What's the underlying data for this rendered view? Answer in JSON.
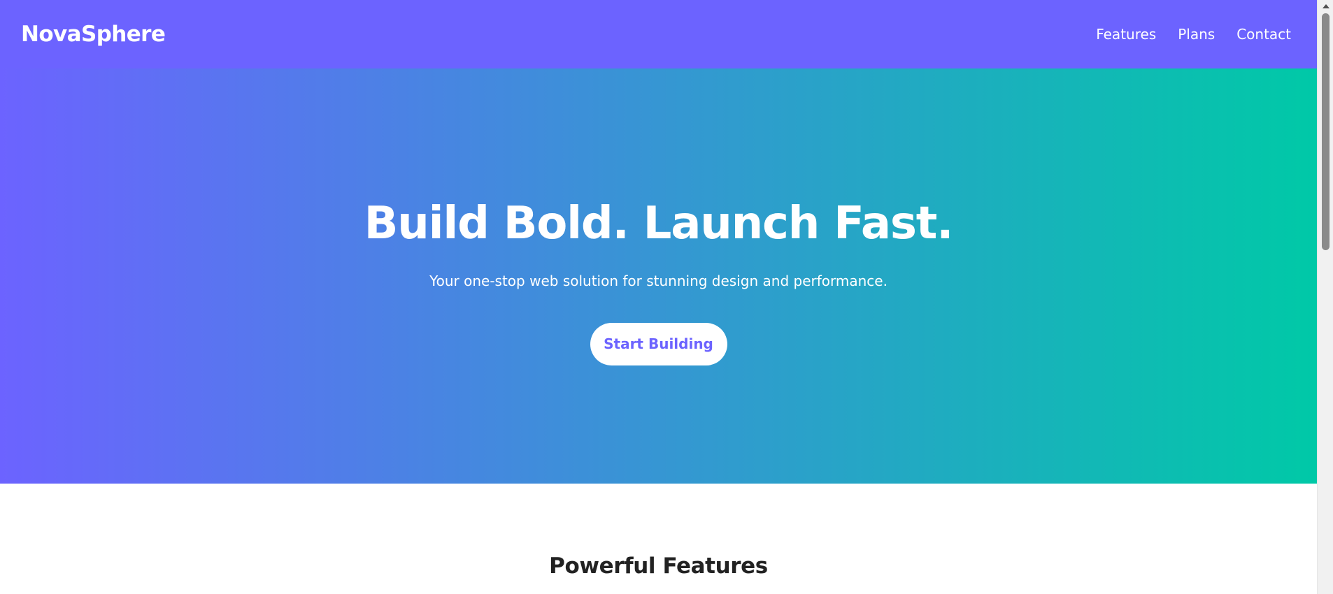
{
  "header": {
    "brand": "NovaSphere",
    "nav": [
      {
        "label": "Features"
      },
      {
        "label": "Plans"
      },
      {
        "label": "Contact"
      }
    ]
  },
  "hero": {
    "title": "Build Bold. Launch Fast.",
    "subtitle": "Your one-stop web solution for stunning design and performance.",
    "cta_label": "Start Building"
  },
  "features": {
    "title": "Powerful Features"
  },
  "colors": {
    "header_bg": "#6c63ff",
    "gradient_start": "#6c63ff",
    "gradient_end": "#00c9a7",
    "cta_text": "#6c63ff",
    "heading_dark": "#222222"
  },
  "scrollbar": {
    "scroll_fraction": 0.0
  }
}
